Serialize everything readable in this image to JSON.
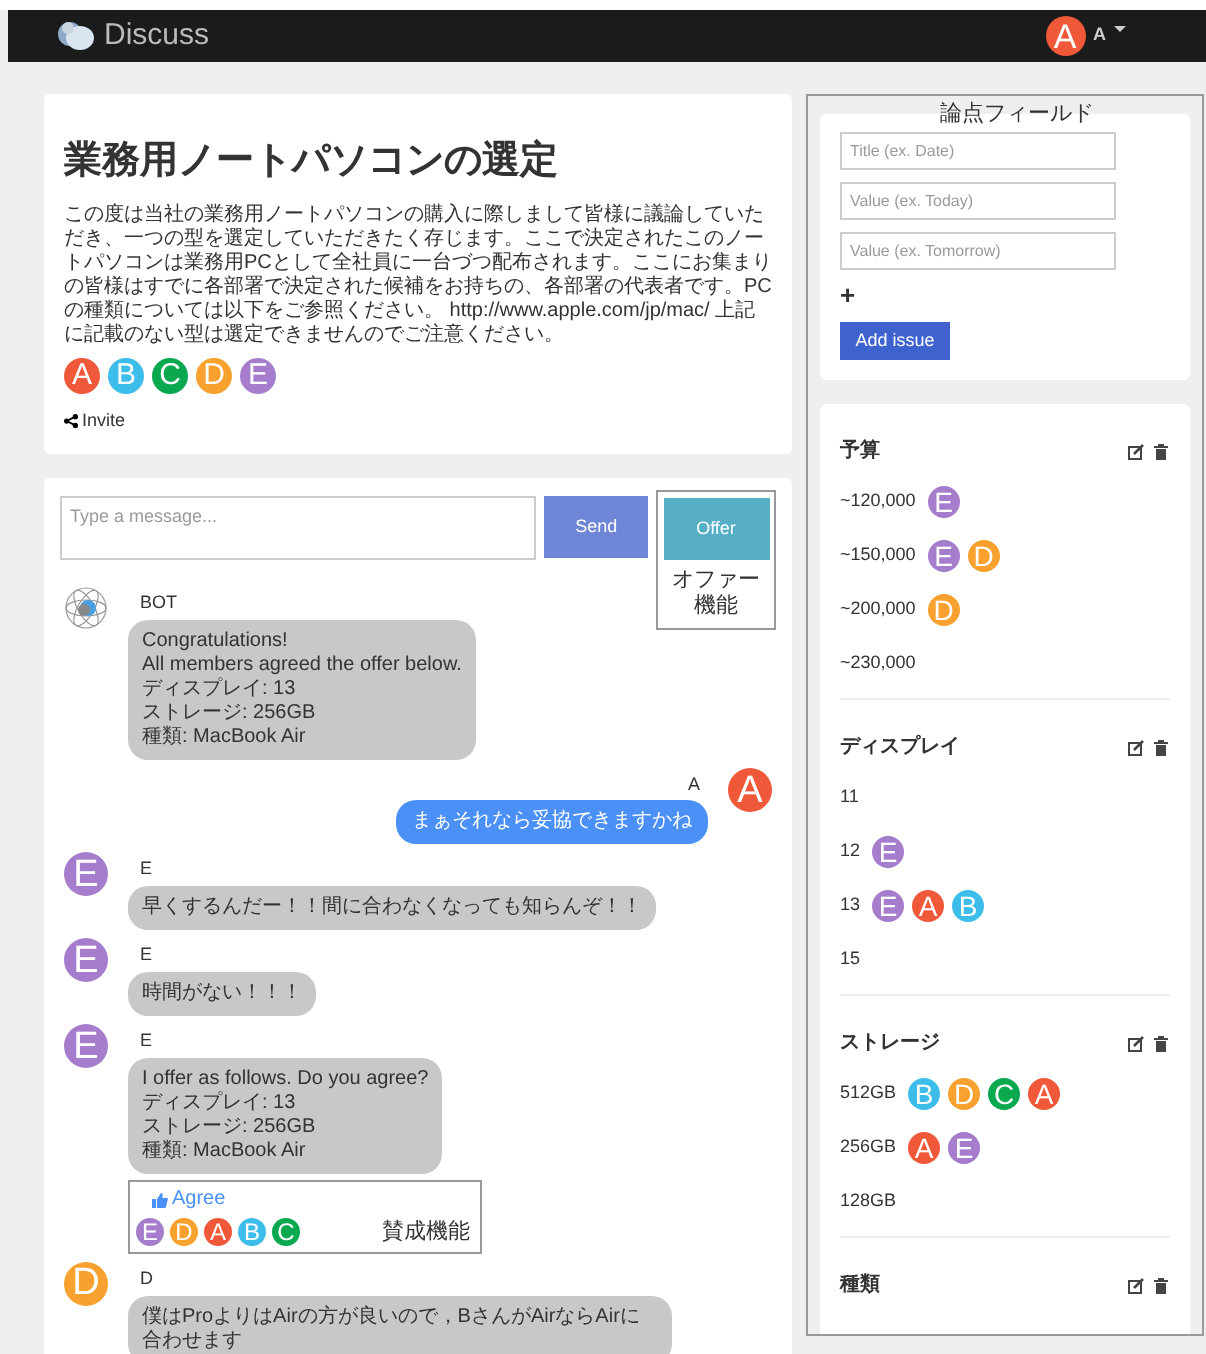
{
  "navbar": {
    "brand": "Discuss",
    "user_avatar": {
      "letter": "A",
      "color": "#f0583a"
    },
    "user_name": "A"
  },
  "topic": {
    "title": "業務用ノートパソコンの選定",
    "description": "この度は当社の業務用ノートパソコンの購入に際しまして皆様に議論していただき、一つの型を選定していただきたく存じます。ここで決定されたこのノートパソコンは業務用PCとして全社員に一台づつ配布されます。ここにお集まりの皆様はすでに各部署で決定された候補をお持ちの、各部署の代表者です。PCの種類については以下をご参照ください。 http://www.apple.com/jp/mac/ 上記に記載のない型は選定できませんのでご注意ください。",
    "members": [
      {
        "letter": "A",
        "color": "#f0583a"
      },
      {
        "letter": "B",
        "color": "#3dbde9"
      },
      {
        "letter": "C",
        "color": "#0aa84f"
      },
      {
        "letter": "D",
        "color": "#f8a12e"
      },
      {
        "letter": "E",
        "color": "#a67dcd"
      }
    ],
    "invite": "Invite"
  },
  "chat": {
    "placeholder": "Type a message...",
    "send": "Send",
    "offer": "Offer",
    "offer_note": "オファー機能",
    "messages": [
      {
        "kind": "bot",
        "author": "BOT",
        "lines": [
          "Congratulations!",
          "All members agreed the offer below.",
          "ディスプレイ: 13",
          "ストレージ: 256GB",
          "種類: MacBook Air"
        ]
      },
      {
        "kind": "self",
        "author": "A",
        "avatar": {
          "letter": "A",
          "color": "#f0583a"
        },
        "lines": [
          "まぁそれなら妥協できますかね"
        ]
      },
      {
        "kind": "other",
        "author": "E",
        "avatar": {
          "letter": "E",
          "color": "#a67dcd"
        },
        "lines": [
          "早くするんだー！！間に合わなくなっても知らんぞ！！"
        ]
      },
      {
        "kind": "other",
        "author": "E",
        "avatar": {
          "letter": "E",
          "color": "#a67dcd"
        },
        "lines": [
          "時間がない！！！"
        ]
      },
      {
        "kind": "other",
        "author": "E",
        "avatar": {
          "letter": "E",
          "color": "#a67dcd"
        },
        "lines": [
          "I offer as follows. Do you agree?",
          "ディスプレイ: 13",
          "ストレージ: 256GB",
          "種類: MacBook Air"
        ],
        "agree": {
          "label": "Agree",
          "note": "賛成機能",
          "voters": [
            {
              "letter": "E",
              "color": "#a67dcd"
            },
            {
              "letter": "D",
              "color": "#f8a12e"
            },
            {
              "letter": "A",
              "color": "#f0583a"
            },
            {
              "letter": "B",
              "color": "#3dbde9"
            },
            {
              "letter": "C",
              "color": "#0aa84f"
            }
          ]
        }
      },
      {
        "kind": "other",
        "author": "D",
        "avatar": {
          "letter": "D",
          "color": "#f8a12e"
        },
        "lines": [
          "僕はProよりはAirの方が良いので，BさんがAirならAirに合わせます"
        ]
      }
    ]
  },
  "issue_panel": {
    "note": "論点フィールド",
    "title_placeholder": "Title (ex. Date)",
    "value_placeholders": [
      "Value (ex. Today)",
      "Value (ex. Tomorrow)"
    ],
    "add_icon": "+",
    "add_button": "Add issue",
    "issues": [
      {
        "title": "予算",
        "options": [
          {
            "value": "~120,000",
            "voters": [
              {
                "letter": "E",
                "color": "#a67dcd"
              }
            ]
          },
          {
            "value": "~150,000",
            "voters": [
              {
                "letter": "E",
                "color": "#a67dcd"
              },
              {
                "letter": "D",
                "color": "#f8a12e"
              }
            ]
          },
          {
            "value": "~200,000",
            "voters": [
              {
                "letter": "D",
                "color": "#f8a12e"
              }
            ]
          },
          {
            "value": "~230,000"
          }
        ]
      },
      {
        "title": "ディスプレイ",
        "options": [
          {
            "value": "11"
          },
          {
            "value": "12",
            "voters": [
              {
                "letter": "E",
                "color": "#a67dcd"
              }
            ]
          },
          {
            "value": "13",
            "voters": [
              {
                "letter": "E",
                "color": "#a67dcd"
              },
              {
                "letter": "A",
                "color": "#f0583a"
              },
              {
                "letter": "B",
                "color": "#3dbde9"
              }
            ]
          },
          {
            "value": "15"
          }
        ]
      },
      {
        "title": "ストレージ",
        "options": [
          {
            "value": "512GB",
            "voters": [
              {
                "letter": "B",
                "color": "#3dbde9"
              },
              {
                "letter": "D",
                "color": "#f8a12e"
              },
              {
                "letter": "C",
                "color": "#0aa84f"
              },
              {
                "letter": "A",
                "color": "#f0583a"
              }
            ]
          },
          {
            "value": "256GB",
            "voters": [
              {
                "letter": "A",
                "color": "#f0583a"
              },
              {
                "letter": "E",
                "color": "#a67dcd"
              }
            ]
          },
          {
            "value": "128GB"
          }
        ]
      },
      {
        "title": "種類"
      }
    ]
  }
}
